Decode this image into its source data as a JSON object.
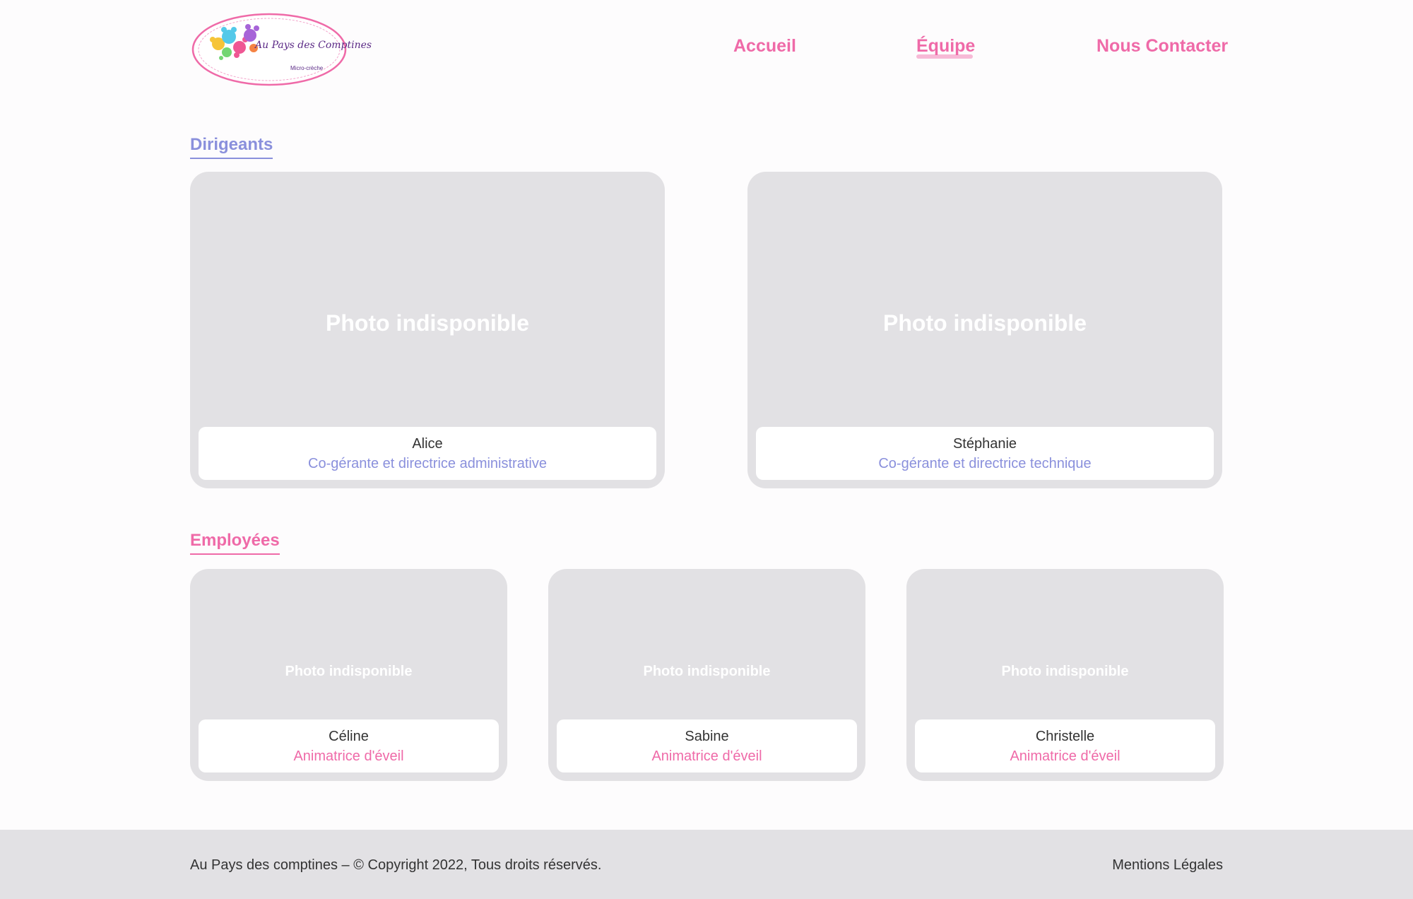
{
  "colors": {
    "pink": "#ef6aa8",
    "lavender": "#8a90dc",
    "card_bg": "#e2e1e4",
    "footer_bg": "#e2e1e4"
  },
  "header": {
    "logo": {
      "title": "Au Pays des Comptines",
      "subtitle": "Micro-crèche",
      "ring_text": "Sur le pont d'Avignon on y danse, on y danse, sur le pont d'Avignon on y danse tous en rond"
    },
    "nav": [
      {
        "label": "Accueil",
        "active": false
      },
      {
        "label": "Équipe",
        "active": true
      },
      {
        "label": "Nous Contacter",
        "active": false
      }
    ]
  },
  "sections": {
    "dirigeants": {
      "title": "Dirigeants",
      "members": [
        {
          "photo_text": "Photo indisponible",
          "name": "Alice",
          "role": "Co-gérante et directrice administrative"
        },
        {
          "photo_text": "Photo indisponible",
          "name": "Stéphanie",
          "role": "Co-gérante et directrice technique"
        }
      ]
    },
    "employees": {
      "title": "Employées",
      "members": [
        {
          "photo_text": "Photo indisponible",
          "name": "Céline",
          "role": "Animatrice d'éveil"
        },
        {
          "photo_text": "Photo indisponible",
          "name": "Sabine",
          "role": "Animatrice d'éveil"
        },
        {
          "photo_text": "Photo indisponible",
          "name": "Christelle",
          "role": "Animatrice d'éveil"
        }
      ]
    }
  },
  "footer": {
    "copyright": "Au Pays des comptines – © Copyright 2022, Tous droits réservés.",
    "legal_link": "Mentions Légales"
  }
}
